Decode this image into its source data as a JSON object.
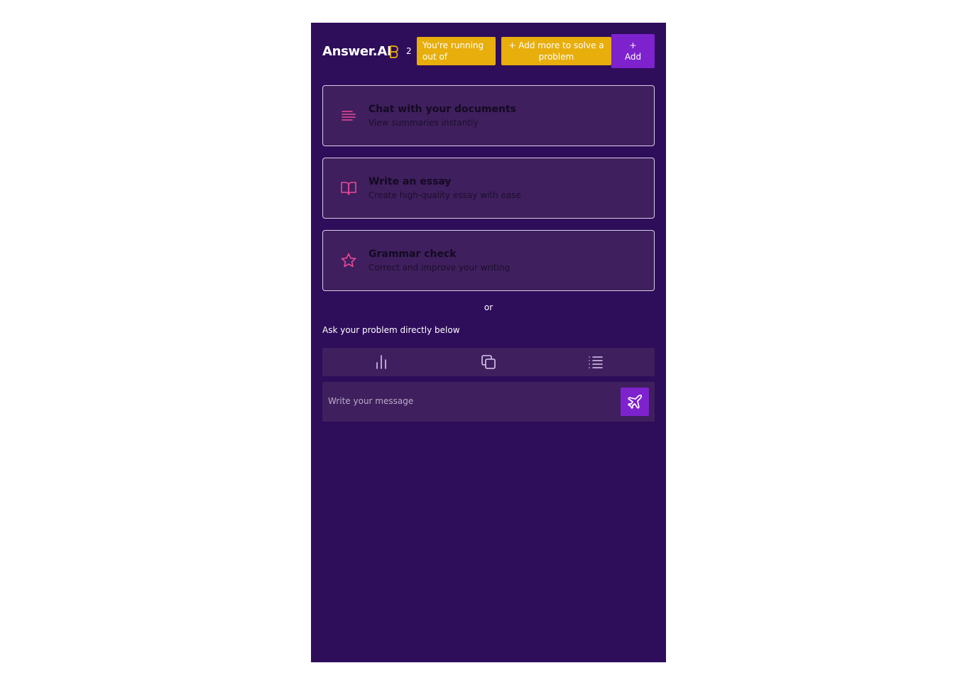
{
  "header": {
    "brand": "Answer.AI",
    "credits": "2",
    "warning": "You're running out of",
    "add_more": "+ Add more to solve a problem",
    "add_button": "+\nAdd"
  },
  "cards": [
    {
      "title": "Chat with your documents",
      "subtitle": "View summaries instantly",
      "icon": "align-left-icon"
    },
    {
      "title": "Write an essay",
      "subtitle": "Create high-quality essay with ease",
      "icon": "book-open-icon"
    },
    {
      "title": "Grammar check",
      "subtitle": "Correct and improve your writing",
      "icon": "star-icon"
    }
  ],
  "divider_text": "or",
  "ask_label": "Ask your problem directly below",
  "toolbar": {
    "icons": [
      "bar-chart-icon",
      "copy-icon",
      "list-icon"
    ]
  },
  "composer": {
    "placeholder": "Write your message",
    "send_icon": "plane-icon"
  },
  "colors": {
    "background": "#2e0d5b",
    "card": "#3f1f5d",
    "accent_yellow": "#e8ae0c",
    "accent_purple": "#7e22ce",
    "icon_pink": "#ec4899"
  }
}
